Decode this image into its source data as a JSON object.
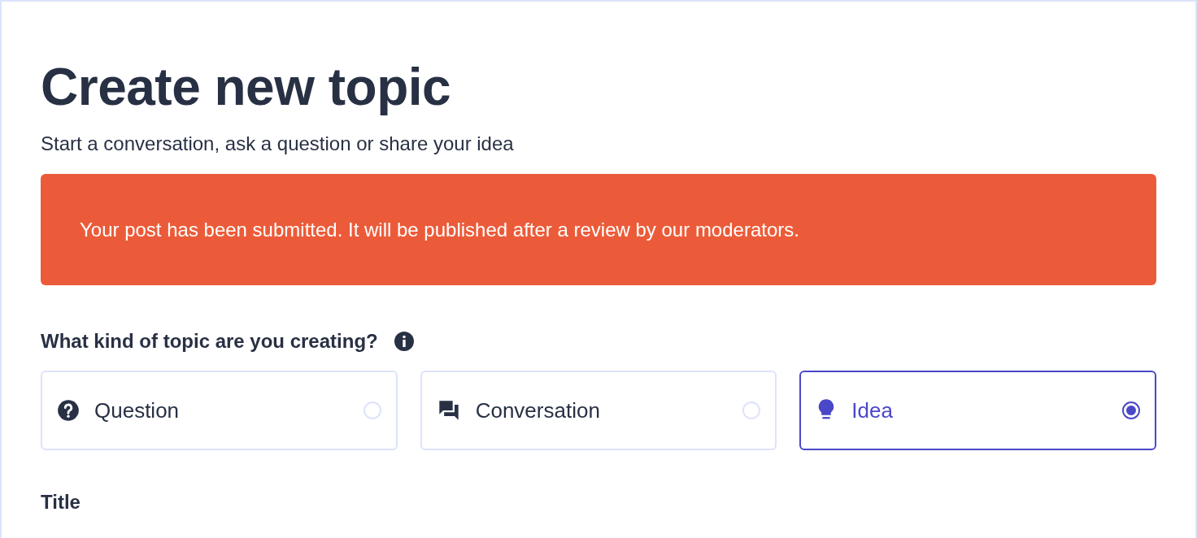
{
  "heading": "Create new topic",
  "subtitle": "Start a conversation, ask a question or share your idea",
  "notice": "Your post has been submitted. It will be published after a review by our moderators.",
  "topic_type": {
    "label": "What kind of topic are you creating?",
    "options": [
      {
        "kind": "question",
        "label": "Question",
        "selected": false
      },
      {
        "kind": "conversation",
        "label": "Conversation",
        "selected": false
      },
      {
        "kind": "idea",
        "label": "Idea",
        "selected": true
      }
    ]
  },
  "title_field": {
    "label": "Title"
  }
}
